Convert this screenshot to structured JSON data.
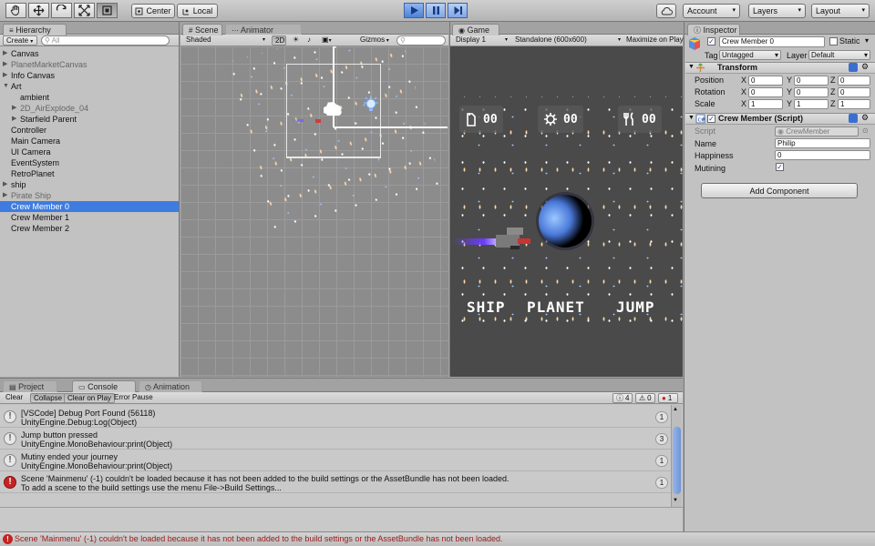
{
  "toolbar": {
    "tools": [
      "hand-tool-icon",
      "move-tool-icon",
      "rotate-tool-icon",
      "scale-tool-icon",
      "rect-tool-icon"
    ],
    "pivot_label": "Center",
    "space_label": "Local",
    "account_label": "Account",
    "layers_label": "Layers",
    "layout_label": "Layout"
  },
  "hierarchy": {
    "tab": "Hierarchy",
    "create_label": "Create",
    "search_placeholder": "All",
    "items": [
      {
        "label": "Canvas",
        "indent": 0,
        "expand": true,
        "dim": false,
        "selected": false
      },
      {
        "label": "PlanetMarketCanvas",
        "indent": 0,
        "expand": true,
        "dim": true,
        "selected": false
      },
      {
        "label": "Info Canvas",
        "indent": 0,
        "expand": true,
        "dim": false,
        "selected": false
      },
      {
        "label": "Art",
        "indent": 0,
        "expand": true,
        "open": true,
        "dim": false,
        "selected": false
      },
      {
        "label": "ambient",
        "indent": 1,
        "expand": false,
        "dim": false,
        "selected": false
      },
      {
        "label": "2D_AirExplode_04",
        "indent": 1,
        "expand": true,
        "dim": true,
        "selected": false
      },
      {
        "label": "Starfield Parent",
        "indent": 1,
        "expand": true,
        "dim": false,
        "selected": false
      },
      {
        "label": "Controller",
        "indent": 0,
        "expand": false,
        "dim": false,
        "selected": false
      },
      {
        "label": "Main Camera",
        "indent": 0,
        "expand": false,
        "dim": false,
        "selected": false
      },
      {
        "label": "UI Camera",
        "indent": 0,
        "expand": false,
        "dim": false,
        "selected": false
      },
      {
        "label": "EventSystem",
        "indent": 0,
        "expand": false,
        "dim": false,
        "selected": false
      },
      {
        "label": "RetroPlanet",
        "indent": 0,
        "expand": false,
        "dim": false,
        "selected": false
      },
      {
        "label": "ship",
        "indent": 0,
        "expand": true,
        "dim": false,
        "selected": false
      },
      {
        "label": "Pirate Ship",
        "indent": 0,
        "expand": true,
        "dim": true,
        "selected": false
      },
      {
        "label": "Crew Member 0",
        "indent": 0,
        "expand": false,
        "dim": false,
        "selected": true
      },
      {
        "label": "Crew Member 1",
        "indent": 0,
        "expand": false,
        "dim": false,
        "selected": false
      },
      {
        "label": "Crew Member 2",
        "indent": 0,
        "expand": false,
        "dim": false,
        "selected": false
      }
    ]
  },
  "scene": {
    "tab_scene": "Scene",
    "tab_animator": "Animator",
    "shading": "Shaded",
    "mode_2d": "2D",
    "gizmos": "Gizmos",
    "search_placeholder": "All"
  },
  "game": {
    "tab": "Game",
    "display": "Display 1",
    "resolution": "Standalone (600x600)",
    "maximize": "Maximize on Play",
    "hud": [
      {
        "icon": "fuel-can-icon",
        "value": "00"
      },
      {
        "icon": "gear-icon",
        "value": "00"
      },
      {
        "icon": "food-icon",
        "value": "00"
      }
    ],
    "buttons": [
      "SHIP",
      "PLANET",
      "JUMP"
    ]
  },
  "inspector": {
    "tab": "Inspector",
    "object_name": "Crew Member 0",
    "static_label": "Static",
    "tag_label": "Tag",
    "tag_value": "Untagged",
    "layer_label": "Layer",
    "layer_value": "Default",
    "transform": {
      "title": "Transform",
      "rows": [
        {
          "label": "Position",
          "x": "0",
          "y": "0",
          "z": "0"
        },
        {
          "label": "Rotation",
          "x": "0",
          "y": "0",
          "z": "0"
        },
        {
          "label": "Scale",
          "x": "1",
          "y": "1",
          "z": "1"
        }
      ]
    },
    "component": {
      "title": "Crew Member (Script)",
      "script_label": "Script",
      "script_value": "CrewMember",
      "name_label": "Name",
      "name_value": "Philip",
      "happiness_label": "Happiness",
      "happiness_value": "0",
      "mutining_label": "Mutining",
      "mutining_checked": true
    },
    "add_component": "Add Component"
  },
  "console": {
    "tabs": [
      "Project",
      "Console",
      "Animation"
    ],
    "clear": "Clear",
    "collapse": "Collapse",
    "clear_on_play": "Clear on Play",
    "error_pause": "Error Pause",
    "info_count": "4",
    "warn_count": "0",
    "error_count": "1",
    "entries": [
      {
        "type": "info",
        "line1": "[VSCode] Debug Port Found (56118)",
        "line2": "UnityEngine.Debug:Log(Object)",
        "count": "1"
      },
      {
        "type": "info",
        "line1": "Jump button pressed",
        "line2": "UnityEngine.MonoBehaviour:print(Object)",
        "count": "3"
      },
      {
        "type": "info",
        "line1": "Mutiny ended your journey",
        "line2": "UnityEngine.MonoBehaviour:print(Object)",
        "count": "1"
      },
      {
        "type": "error",
        "line1": "Scene 'Mainmenu' (-1) couldn't be loaded because it has not been added to the build settings or the AssetBundle has not been loaded.",
        "line2": "To add a scene to the build settings use the menu File->Build Settings...",
        "count": "1"
      }
    ]
  },
  "status_bar": {
    "message": "Scene 'Mainmenu' (-1) couldn't be loaded because it has not been added to the build settings or the AssetBundle has not been loaded."
  }
}
